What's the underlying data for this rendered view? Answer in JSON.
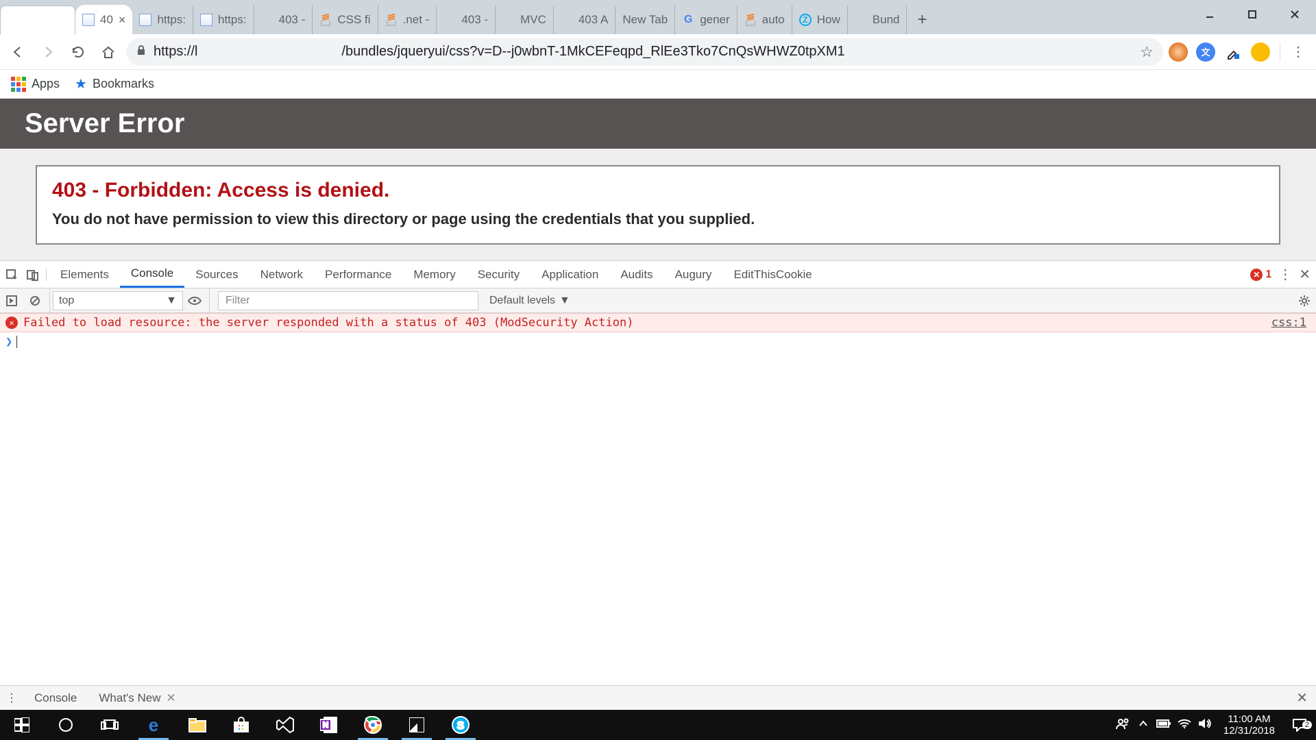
{
  "tabs": [
    {
      "label": "",
      "type": "blank"
    },
    {
      "label": "40",
      "type": "iis",
      "active": true,
      "closable": true
    },
    {
      "label": "https:",
      "type": "iis"
    },
    {
      "label": "https:",
      "type": "iis"
    },
    {
      "label": "403 -",
      "type": "ms"
    },
    {
      "label": "CSS fi",
      "type": "so"
    },
    {
      "label": ".net -",
      "type": "so"
    },
    {
      "label": "403 -",
      "type": "ms"
    },
    {
      "label": "MVC",
      "type": "ms"
    },
    {
      "label": "403 A",
      "type": "ms"
    },
    {
      "label": "New Tab",
      "type": "none"
    },
    {
      "label": "gener",
      "type": "g"
    },
    {
      "label": "auto",
      "type": "so"
    },
    {
      "label": "How",
      "type": "z"
    },
    {
      "label": "Bund",
      "type": "ms"
    }
  ],
  "url_prefix": "https://l",
  "url_suffix": "/bundles/jqueryui/css?v=D--j0wbnT-1MkCEFeqpd_RlEe3Tko7CnQsWHWZ0tpXM1",
  "bookmarks": {
    "apps": "Apps",
    "bookmarks": "Bookmarks"
  },
  "page": {
    "header": "Server Error",
    "title": "403 - Forbidden: Access is denied.",
    "sub": "You do not have permission to view this directory or page using the credentials that you supplied."
  },
  "devtools": {
    "tabs": [
      "Elements",
      "Console",
      "Sources",
      "Network",
      "Performance",
      "Memory",
      "Security",
      "Application",
      "Audits",
      "Augury",
      "EditThisCookie"
    ],
    "active": "Console",
    "error_count": "1",
    "context": "top",
    "filter_placeholder": "Filter",
    "levels": "Default levels",
    "log_msg": "Failed to load resource: the server responded with a status of 403 (ModSecurity Action)",
    "log_src": "css:1",
    "drawer": [
      "Console",
      "What's New"
    ]
  },
  "clock": {
    "time": "11:00 AM",
    "date": "12/31/2018"
  },
  "action_center_badge": "2"
}
